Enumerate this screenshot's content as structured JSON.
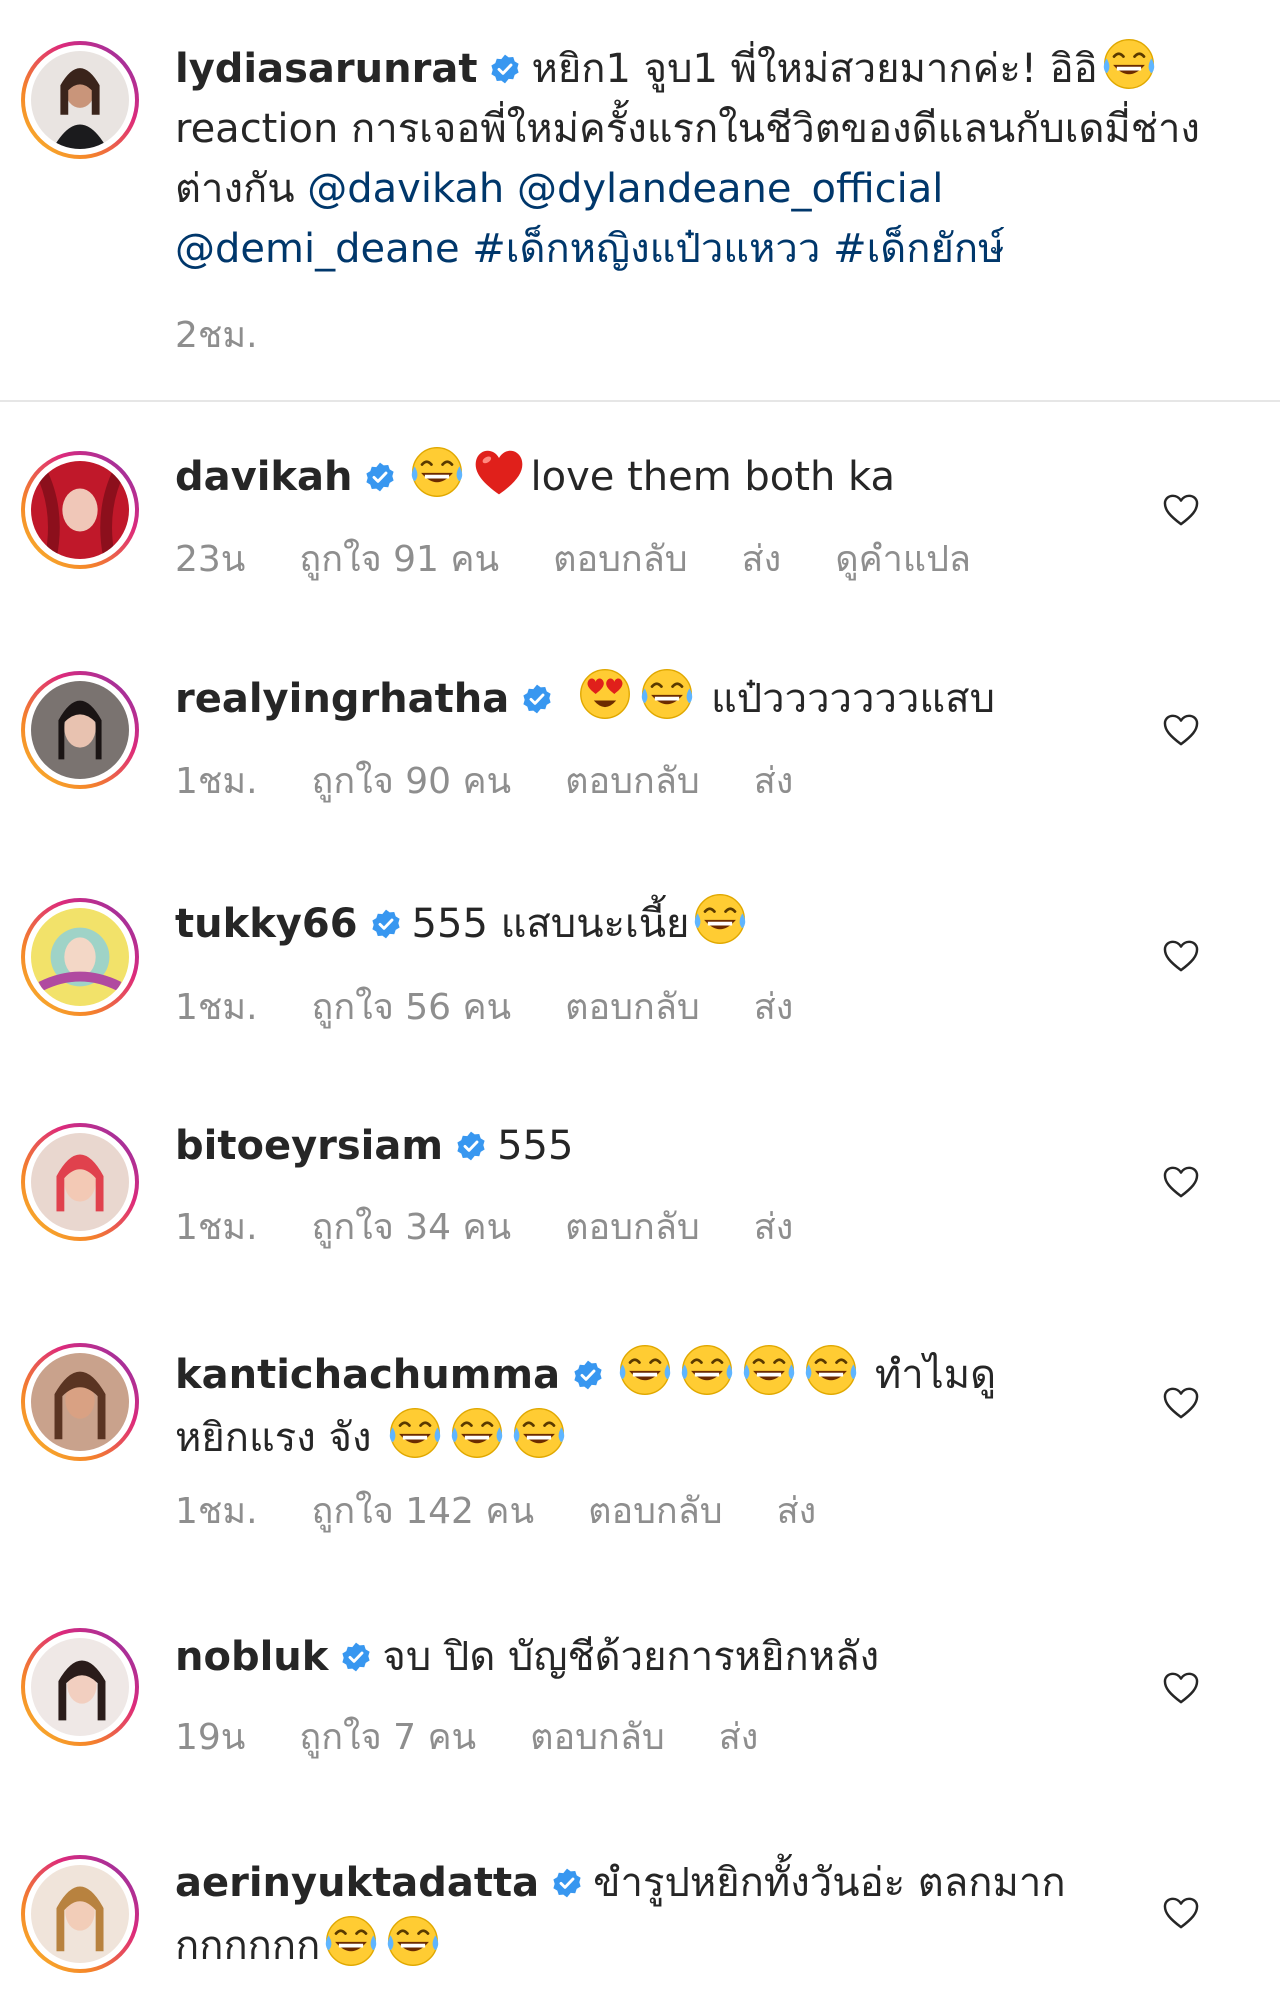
{
  "post": {
    "username": "lydiasarunrat",
    "caption_part1": "หยิก1 จูบ1 พี่ใหม่สวยมากค่ะ! อิอิ",
    "caption_part2": "reaction การเจอพี่ใหม่ครั้งแรกในชีวิตของดีแลนกับเดมี่ช่างต่างกัน",
    "mentions": [
      "@davikah",
      "@dylandeane_official",
      "@demi_deane"
    ],
    "hashtags": [
      "#เด็กหญิงแป๋วแหวว",
      "#เด็กยักษ์"
    ],
    "time": "2ชม."
  },
  "comments": [
    {
      "username": "davikah",
      "text": "love them both ka",
      "time": "23น",
      "likes": "ถูกใจ 91 คน",
      "reply": "ตอบกลับ",
      "send": "ส่ง",
      "translate": "ดูคำแปล"
    },
    {
      "username": "realyingrhatha",
      "text": "แป๋วววววววแสบ",
      "time": "1ชม.",
      "likes": "ถูกใจ 90 คน",
      "reply": "ตอบกลับ",
      "send": "ส่ง"
    },
    {
      "username": "tukky66",
      "text": "555 แสบนะเนี้ย",
      "time": "1ชม.",
      "likes": "ถูกใจ 56 คน",
      "reply": "ตอบกลับ",
      "send": "ส่ง"
    },
    {
      "username": "bitoeyrsiam",
      "text": "555",
      "time": "1ชม.",
      "likes": "ถูกใจ 34 คน",
      "reply": "ตอบกลับ",
      "send": "ส่ง"
    },
    {
      "username": "kantichachumma",
      "text1": "ทำไมดู",
      "text2": "หยิกแรง จัง",
      "time": "1ชม.",
      "likes": "ถูกใจ 142 คน",
      "reply": "ตอบกลับ",
      "send": "ส่ง"
    },
    {
      "username": "nobluk",
      "text": "จบ ปิด บัญชีด้วยการหยิกหลัง",
      "time": "19น",
      "likes": "ถูกใจ 7 คน",
      "reply": "ตอบกลับ",
      "send": "ส่ง"
    },
    {
      "username": "aerinyuktadatta",
      "text1": "ขำรูปหยิกทั้งวันอ่ะ ตลกมาก",
      "text2": "กกกกกก"
    }
  ],
  "colors": {
    "text": "#262626",
    "meta": "#8e8e8e",
    "link": "#00376b",
    "verified": "#3897f0"
  },
  "icons": {
    "verified": "verified-badge-icon",
    "heart": "heart-outline-icon",
    "laugh": "tears-of-joy-emoji",
    "heart_emoji": "red-heart-emoji",
    "heart_eyes": "heart-eyes-emoji"
  }
}
